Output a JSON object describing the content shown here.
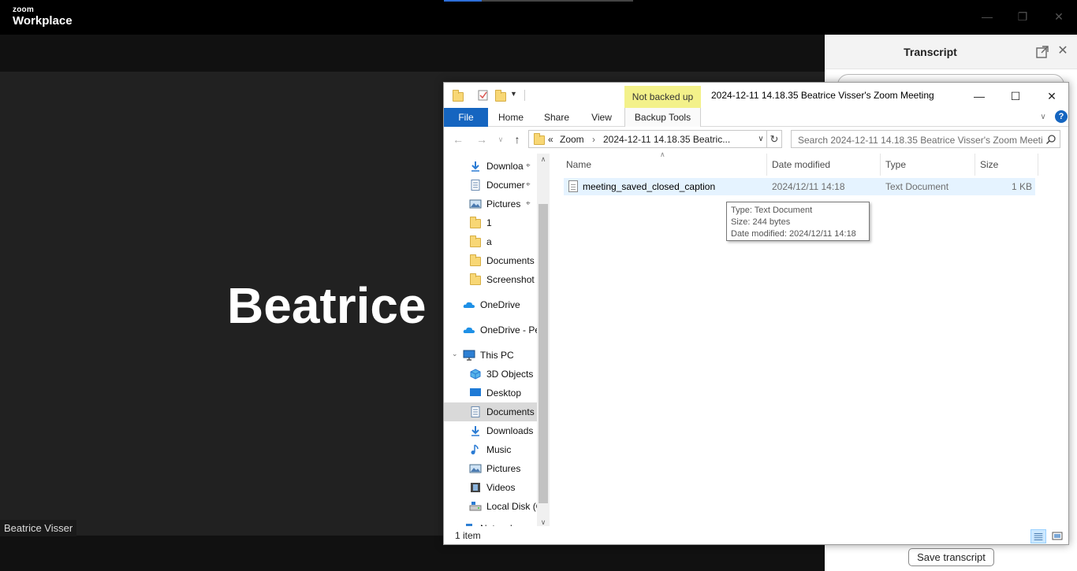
{
  "zoom": {
    "logo_small": "zoom",
    "logo_big": "Workplace",
    "participant_big_name": "Beatrice",
    "participant_name_tag": "Beatrice Visser"
  },
  "transcript": {
    "title": "Transcript",
    "save_button": "Save transcript"
  },
  "explorer": {
    "not_backed_up": "Not backed up",
    "window_title": "2024-12-11 14.18.35 Beatrice Visser's Zoom Meeting",
    "ribbon_tabs": [
      "File",
      "Home",
      "Share",
      "View",
      "Backup Tools"
    ],
    "help": "?",
    "address": {
      "prefix": "«",
      "crumb1": "Zoom",
      "crumb2": "2024-12-11 14.18.35 Beatric..."
    },
    "search_placeholder": "Search 2024-12-11 14.18.35 Beatrice Visser's Zoom Meeti...",
    "nav_items": [
      {
        "label": "Downloa",
        "icon": "download-arrow-icon",
        "pinned": true
      },
      {
        "label": "Documer",
        "icon": "document-icon",
        "pinned": true
      },
      {
        "label": "Pictures",
        "icon": "pictures-icon",
        "pinned": true
      },
      {
        "label": "1",
        "icon": "folder-icon",
        "pinned": false
      },
      {
        "label": "a",
        "icon": "folder-icon",
        "pinned": false
      },
      {
        "label": "Documents",
        "icon": "folder-icon",
        "pinned": false
      },
      {
        "label": "Screenshot E",
        "icon": "folder-icon",
        "pinned": false
      },
      {
        "label": "OneDrive",
        "icon": "cloud-icon",
        "pinned": false
      },
      {
        "label": "OneDrive - Pe",
        "icon": "cloud-icon",
        "pinned": false
      },
      {
        "label": "This PC",
        "icon": "computer-icon",
        "pinned": false
      },
      {
        "label": "3D Objects",
        "icon": "cube-icon",
        "pinned": false
      },
      {
        "label": "Desktop",
        "icon": "desktop-icon",
        "pinned": false
      },
      {
        "label": "Documents",
        "icon": "document-icon",
        "pinned": false,
        "selected": true
      },
      {
        "label": "Downloads",
        "icon": "download-arrow-icon",
        "pinned": false
      },
      {
        "label": "Music",
        "icon": "music-note-icon",
        "pinned": false
      },
      {
        "label": "Pictures",
        "icon": "pictures-icon",
        "pinned": false
      },
      {
        "label": "Videos",
        "icon": "film-icon",
        "pinned": false
      },
      {
        "label": "Local Disk (C",
        "icon": "disk-icon",
        "pinned": false
      },
      {
        "label": "Network",
        "icon": "network-icon",
        "pinned": false
      }
    ],
    "columns": [
      "Name",
      "Date modified",
      "Type",
      "Size"
    ],
    "files": [
      {
        "name": "meeting_saved_closed_caption",
        "date": "2024/12/11 14:18",
        "type": "Text Document",
        "size": "1 KB"
      }
    ],
    "tooltip": {
      "line1": "Type: Text Document",
      "line2": "Size: 244 bytes",
      "line3": "Date modified: 2024/12/11 14:18"
    },
    "status": "1 item"
  },
  "colors": {
    "file_tab_blue": "#1565c0",
    "not_backed_yellow": "#f3f18a",
    "row_highlight": "#e5f3ff",
    "video_bg": "#212121"
  }
}
